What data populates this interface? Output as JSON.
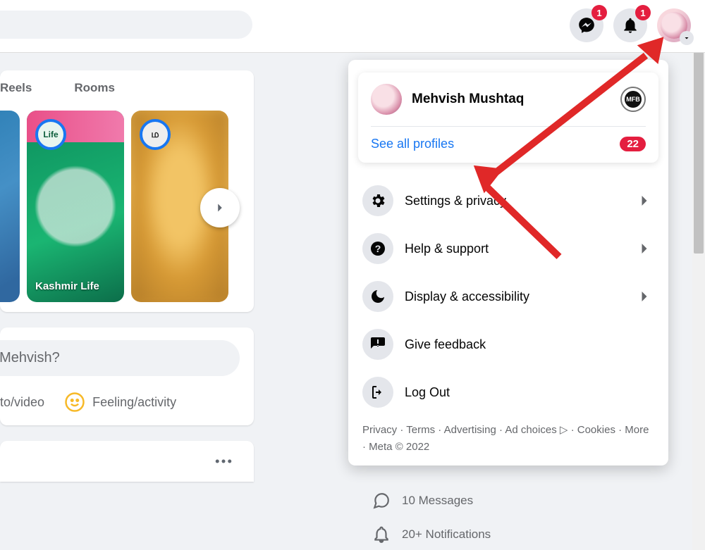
{
  "topbar": {
    "messenger_badge": "1",
    "notifications_badge": "1"
  },
  "tabs": {
    "reels": "Reels",
    "rooms": "Rooms"
  },
  "stories": {
    "kashmir_life": "Kashmir Life",
    "life_logo": "Life"
  },
  "composer": {
    "prompt": ", Mehvish?",
    "photo_video": "hoto/video",
    "feeling": "Feeling/activity"
  },
  "profile": {
    "name": "Mehvish Mushtaq",
    "see_all": "See all profiles",
    "badge": "22"
  },
  "menu": {
    "settings": "Settings & privacy",
    "help": "Help & support",
    "display": "Display & accessibility",
    "feedback": "Give feedback",
    "logout": "Log Out"
  },
  "footer": {
    "l0": "Privacy",
    "l1": "Terms",
    "l2": "Advertising",
    "l3": "Ad choices",
    "l4": "Cookies",
    "l5": "More",
    "l6": "Meta © 2022"
  },
  "bg": {
    "messages": "10 Messages",
    "notifications": "20+ Notifications"
  }
}
